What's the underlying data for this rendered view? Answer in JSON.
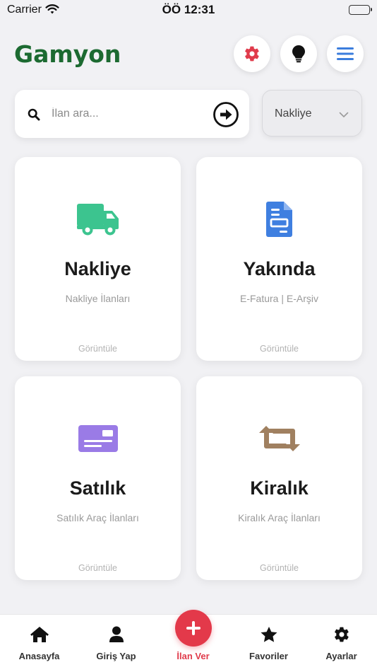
{
  "status_bar": {
    "carrier": "Carrier",
    "time": "ÖÖ 12:31",
    "battery_level": 1.0
  },
  "header": {
    "logo_text": "Gamyon",
    "logo_color": "#1f6f34",
    "buttons": [
      {
        "name": "settings",
        "icon": "gear-icon",
        "color": "#e03b4b"
      },
      {
        "name": "tips",
        "icon": "lightbulb-icon",
        "color": "#111111"
      },
      {
        "name": "menu",
        "icon": "hamburger-menu-icon",
        "color": "#3b7ddd"
      }
    ]
  },
  "search": {
    "placeholder": "İlan ara...",
    "value": "",
    "submit_icon": "arrow-circle-right-icon"
  },
  "category_select": {
    "selected": "Nakliye"
  },
  "cards": [
    {
      "title": "Nakliye",
      "subtitle": "Nakliye İlanları",
      "action": "Görüntüle",
      "icon": "truck-icon",
      "icon_color": "#3cc48f"
    },
    {
      "title": "Yakında",
      "subtitle": "E-Fatura | E-Arşiv",
      "action": "Görüntüle",
      "icon": "document-icon",
      "icon_color": "#3f7fe0"
    },
    {
      "title": "Satılık",
      "subtitle": "Satılık Araç İlanları",
      "action": "Görüntüle",
      "icon": "money-card-icon",
      "icon_color": "#9a7be6"
    },
    {
      "title": "Kiralık",
      "subtitle": "Kiralık Araç İlanları",
      "action": "Görüntüle",
      "icon": "retweet-icon",
      "icon_color": "#a08060"
    }
  ],
  "tab_bar": {
    "items": [
      {
        "label": "Anasayfa",
        "icon": "home-icon"
      },
      {
        "label": "Giriş Yap",
        "icon": "user-icon"
      },
      {
        "label": "İlan Ver",
        "icon": "plus-icon",
        "active": true,
        "color": "#e3394a"
      },
      {
        "label": "Favoriler",
        "icon": "star-icon"
      },
      {
        "label": "Ayarlar",
        "icon": "gear-icon"
      }
    ]
  }
}
